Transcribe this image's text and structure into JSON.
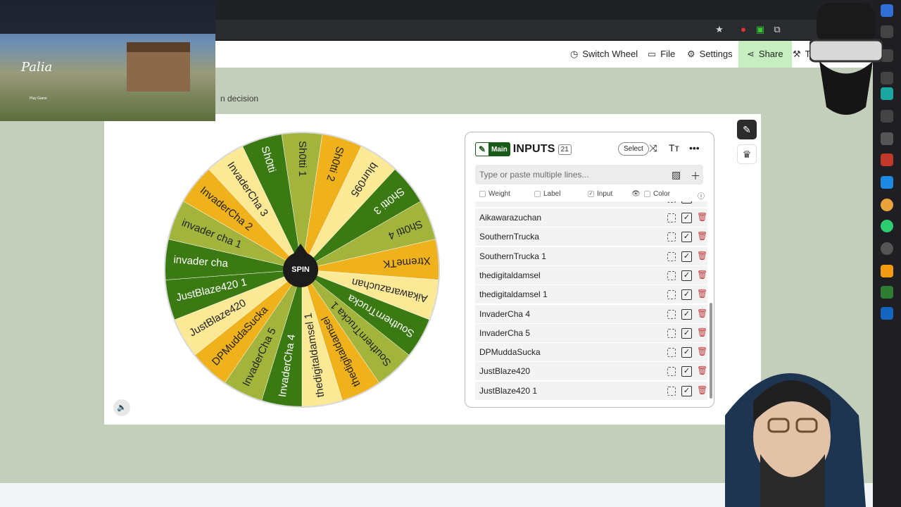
{
  "app": {
    "header": {
      "switch_wheel": "Switch Wheel",
      "file": "File",
      "settings": "Settings",
      "share": "Share",
      "tools": "Tools"
    },
    "subtitle_partial": "n decision"
  },
  "wheel": {
    "spin_label": "SPIN",
    "segments": [
      {
        "label": "Sh0tti 1",
        "color": "#a3b43c"
      },
      {
        "label": "Sh0tti 2",
        "color": "#efb21d"
      },
      {
        "label": "blurr095",
        "color": "#fbe996"
      },
      {
        "label": "Sh0tti 3",
        "color": "#3b7a12"
      },
      {
        "label": "Sh0tti 4",
        "color": "#a3b43c"
      },
      {
        "label": "XtremeTK",
        "color": "#efb21d"
      },
      {
        "label": "Aikawarazuchan",
        "color": "#fbe996"
      },
      {
        "label": "SouthernTrucka",
        "color": "#3b7a12"
      },
      {
        "label": "SouthernTrucka 1",
        "color": "#a3b43c"
      },
      {
        "label": "thedigitaldamsel",
        "color": "#efb21d"
      },
      {
        "label": "thedigitaldamsel 1",
        "color": "#fbe996"
      },
      {
        "label": "InvaderCha 4",
        "color": "#3b7a12"
      },
      {
        "label": "InvaderCha 5",
        "color": "#a3b43c"
      },
      {
        "label": "DPMuddaSucka",
        "color": "#efb21d"
      },
      {
        "label": "JustBlaze420",
        "color": "#fbe996"
      },
      {
        "label": "JustBlaze420 1",
        "color": "#3b7a12"
      },
      {
        "label": "invader cha",
        "color": "#3b7a12"
      },
      {
        "label": "invader cha 1",
        "color": "#a3b43c"
      },
      {
        "label": "InvaderCha 2",
        "color": "#efb21d"
      },
      {
        "label": "InvaderCha 3",
        "color": "#fbe996"
      },
      {
        "label": "Sh0tti",
        "color": "#3b7a12"
      }
    ]
  },
  "inputs": {
    "badge": "Main",
    "title": "INPUTS",
    "count": "21",
    "select_label": "Select",
    "paste_placeholder": "Type or paste multiple lines...",
    "columns": {
      "weight": "Weight",
      "label": "Label",
      "input": "Input",
      "color": "Color"
    },
    "rows": [
      {
        "label": "Aikawarazuchan"
      },
      {
        "label": "SouthernTrucka"
      },
      {
        "label": "SouthernTrucka 1"
      },
      {
        "label": "thedigitaldamsel"
      },
      {
        "label": "thedigitaldamsel 1"
      },
      {
        "label": "InvaderCha 4"
      },
      {
        "label": "InvaderCha 5"
      },
      {
        "label": "DPMuddaSucka"
      },
      {
        "label": "JustBlaze420"
      },
      {
        "label": "JustBlaze420 1"
      }
    ]
  },
  "overlay": {
    "game_logo": "Palia",
    "game_play": "Play Game"
  }
}
